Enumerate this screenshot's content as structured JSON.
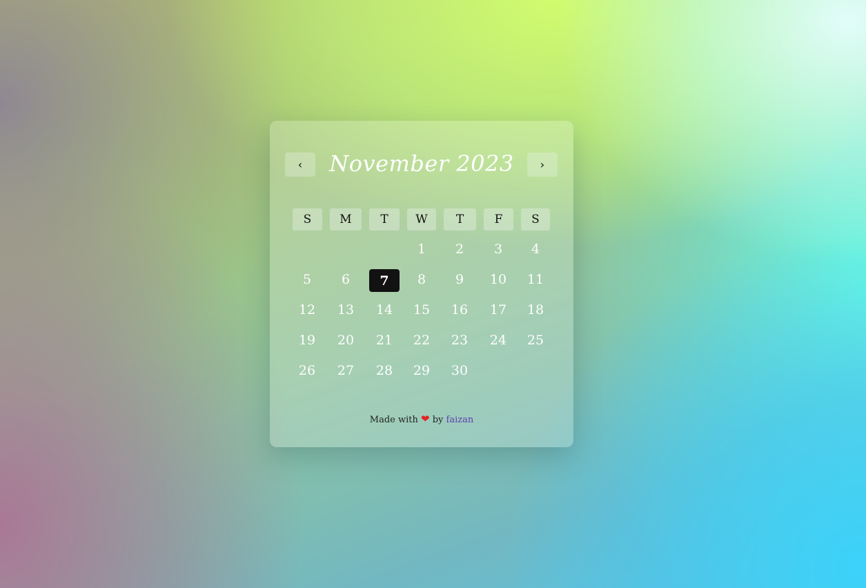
{
  "calendar": {
    "title": "November 2023",
    "prev_label": "‹",
    "next_label": "›",
    "weekdays": [
      "S",
      "M",
      "T",
      "W",
      "T",
      "F",
      "S"
    ],
    "days": [
      "1",
      "2",
      "3",
      "4",
      "5",
      "6",
      "7",
      "8",
      "9",
      "10",
      "11",
      "12",
      "13",
      "14",
      "15",
      "16",
      "17",
      "18",
      "19",
      "20",
      "21",
      "22",
      "23",
      "24",
      "25",
      "26",
      "27",
      "28",
      "29",
      "30"
    ],
    "today": "7"
  },
  "footer": {
    "made_with": "Made with",
    "heart": "❤",
    "by": "by",
    "author": "faizan"
  },
  "colors": {
    "today_bg": "#121212",
    "heart": "#e02424",
    "author_link": "#5a3fb0"
  },
  "icons": {
    "prev": "chevron-left-icon",
    "next": "chevron-right-icon",
    "heart": "heart-icon"
  }
}
